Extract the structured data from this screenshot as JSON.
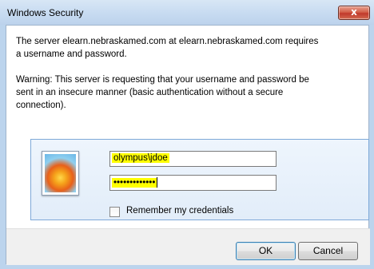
{
  "window": {
    "title": "Windows Security",
    "close_glyph": "x"
  },
  "message": {
    "line1": "The server elearn.nebraskamed.com at elearn.nebraskamed.com requires",
    "line2": "a username and password.",
    "warning1": "Warning: This server is requesting that your username and password be",
    "warning2": "sent in an insecure manner (basic authentication without a secure",
    "warning3": "connection)."
  },
  "credentials": {
    "username": "olympus\\jdoe",
    "password_mask": "•••••••••••••",
    "remember_label": "Remember my credentials",
    "remember_checked": false,
    "avatar_icon": "user-tile-flower-icon",
    "highlight_color": "#ffff00"
  },
  "buttons": {
    "ok": "OK",
    "cancel": "Cancel"
  }
}
